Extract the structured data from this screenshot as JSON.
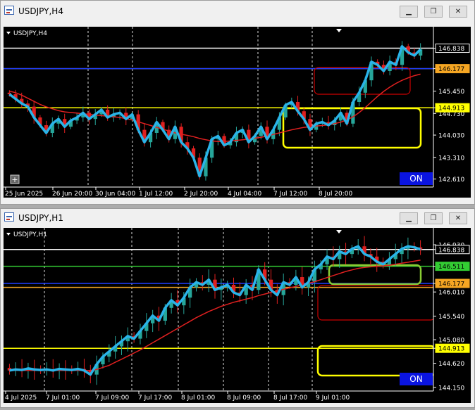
{
  "chart_data": [
    {
      "type": "candlestick",
      "symbol_label": "USDJPY,H4",
      "y_ticks": [
        "146.838",
        "146.177",
        "145.450",
        "144.913",
        "144.730",
        "144.030",
        "143.310",
        "142.610"
      ],
      "x_ticks": [
        "25 Jun 2025",
        "26 Jun 20:00",
        "30 Jun 04:00",
        "1 Jul 12:00",
        "2 Jul 20:00",
        "4 Jul 04:00",
        "7 Jul 12:00",
        "8 Jul 20:00"
      ],
      "horizontal_lines": [
        {
          "price": 146.838,
          "color": "#ffffff"
        },
        {
          "price": 146.177,
          "color": "#f5a623"
        },
        {
          "price": 146.177,
          "color": "#1f3fff"
        },
        {
          "price": 144.913,
          "color": "#ffff00"
        }
      ],
      "price_labels": [
        {
          "text": "146.838",
          "bg": "#000000",
          "fg": "#ffffff"
        },
        {
          "text": "146.177",
          "bg": "#f5a623",
          "fg": "#000000"
        },
        {
          "text": "144.913",
          "bg": "#ffff00",
          "fg": "#000000"
        }
      ],
      "candles_close": [
        145.35,
        145.2,
        145.05,
        144.95,
        144.6,
        144.35,
        144.1,
        144.4,
        144.55,
        144.3,
        144.5,
        144.6,
        144.75,
        144.55,
        144.7,
        144.85,
        144.6,
        144.7,
        144.75,
        144.55,
        144.7,
        144.2,
        143.8,
        144.1,
        144.45,
        144.2,
        143.9,
        144.3,
        143.8,
        143.6,
        143.3,
        142.7,
        143.3,
        143.9,
        144.0,
        143.7,
        143.8,
        144.1,
        144.2,
        143.8,
        144.0,
        144.3,
        143.9,
        144.2,
        144.6,
        145.0,
        145.1,
        144.8,
        144.55,
        144.2,
        144.4,
        144.45,
        144.35,
        144.5,
        144.75,
        144.4,
        145.1,
        145.4,
        145.8,
        146.4,
        146.3,
        146.1,
        146.4,
        146.3,
        146.9,
        146.7,
        146.6,
        146.8
      ],
      "ma_values": [
        145.45,
        145.4,
        145.32,
        145.22,
        145.12,
        145.02,
        144.94,
        144.88,
        144.82,
        144.78,
        144.76,
        144.74,
        144.72,
        144.7,
        144.68,
        144.66,
        144.64,
        144.62,
        144.6,
        144.56,
        144.52,
        144.46,
        144.4,
        144.34,
        144.28,
        144.22,
        144.16,
        144.1,
        144.06,
        144.02,
        143.98,
        143.92,
        143.88,
        143.84,
        143.82,
        143.82,
        143.84,
        143.86,
        143.88,
        143.9,
        143.93,
        143.96,
        144.0,
        144.05,
        144.1,
        144.15,
        144.2,
        144.24,
        144.28,
        144.3,
        144.32,
        144.34,
        144.36,
        144.4,
        144.45,
        144.52,
        144.62,
        144.76,
        144.92,
        145.1,
        145.28,
        145.44,
        145.58,
        145.7,
        145.8,
        145.88,
        145.95,
        146.0
      ],
      "rectangles": [
        {
          "top": 146.1,
          "bottom": 145.4,
          "color": "#cc0000"
        },
        {
          "top": 144.85,
          "bottom": 143.85,
          "color": "#ffff00"
        }
      ],
      "one_click_label": "ON"
    },
    {
      "type": "candlestick",
      "symbol_label": "USDJPY,H1",
      "y_ticks": [
        "146.930",
        "146.838",
        "146.511",
        "146.177",
        "146.010",
        "145.540",
        "145.080",
        "144.913",
        "144.620",
        "144.150"
      ],
      "x_ticks": [
        "4 Jul 2025",
        "7 Jul 01:00",
        "7 Jul 09:00",
        "7 Jul 17:00",
        "8 Jul 01:00",
        "8 Jul 09:00",
        "8 Jul 17:00",
        "9 Jul 01:00"
      ],
      "horizontal_lines": [
        {
          "price": 146.838,
          "color": "#ffffff"
        },
        {
          "price": 146.511,
          "color": "#33cc33"
        },
        {
          "price": 146.177,
          "color": "#1f3fff"
        },
        {
          "price": 146.1,
          "color": "#f5a623"
        },
        {
          "price": 144.913,
          "color": "#ffff00"
        }
      ],
      "price_labels": [
        {
          "text": "146.838",
          "bg": "#000000",
          "fg": "#ffffff"
        },
        {
          "text": "146.511",
          "bg": "#33cc33",
          "fg": "#000000"
        },
        {
          "text": "146.177",
          "bg": "#f5a623",
          "fg": "#000000"
        },
        {
          "text": "144.913",
          "bg": "#ffff00",
          "fg": "#000000"
        }
      ],
      "candles_close": [
        144.48,
        144.5,
        144.49,
        144.52,
        144.5,
        144.49,
        144.5,
        144.48,
        144.51,
        144.5,
        144.49,
        144.51,
        144.48,
        144.4,
        144.6,
        144.75,
        144.85,
        144.95,
        145.05,
        145.15,
        145.1,
        145.25,
        145.4,
        145.55,
        145.45,
        145.7,
        145.85,
        145.75,
        145.9,
        146.1,
        146.2,
        146.15,
        146.25,
        146.05,
        146.1,
        146.15,
        146.0,
        145.95,
        146.15,
        146.05,
        146.45,
        146.25,
        146.05,
        145.95,
        146.2,
        146.15,
        146.3,
        146.1,
        146.2,
        146.45,
        146.55,
        146.7,
        146.65,
        146.8,
        146.75,
        146.85,
        146.9,
        146.75,
        146.7,
        146.6,
        146.55,
        146.65,
        146.75,
        146.85,
        146.9,
        146.88,
        146.84
      ],
      "ma_values": [
        144.48,
        144.48,
        144.48,
        144.48,
        144.48,
        144.48,
        144.48,
        144.48,
        144.48,
        144.48,
        144.48,
        144.48,
        144.48,
        144.48,
        144.5,
        144.54,
        144.58,
        144.64,
        144.7,
        144.76,
        144.82,
        144.88,
        144.95,
        145.02,
        145.09,
        145.16,
        145.23,
        145.3,
        145.37,
        145.44,
        145.51,
        145.57,
        145.63,
        145.68,
        145.73,
        145.77,
        145.81,
        145.84,
        145.87,
        145.9,
        145.94,
        145.97,
        146.0,
        146.03,
        146.06,
        146.09,
        146.12,
        146.15,
        146.18,
        146.21,
        146.25,
        146.29,
        146.33,
        146.37,
        146.41,
        146.44,
        146.47,
        146.49,
        146.5,
        146.51,
        146.52,
        146.53,
        146.55,
        146.57,
        146.59,
        146.61,
        146.63
      ],
      "rectangles": [
        {
          "top": 146.48,
          "bottom": 146.12,
          "color": "#88cc33"
        },
        {
          "top": 146.06,
          "bottom": 145.26,
          "color": "#cc0000"
        },
        {
          "top": 144.9,
          "bottom": 144.3,
          "color": "#ffff00"
        }
      ],
      "one_click_label": "ON"
    }
  ],
  "windows": [
    {
      "title": "USDJPY,H4",
      "buttons": [
        "minimize",
        "restore",
        "close"
      ]
    },
    {
      "title": "USDJPY,H1",
      "buttons": [
        "minimize",
        "restore",
        "close"
      ]
    }
  ]
}
